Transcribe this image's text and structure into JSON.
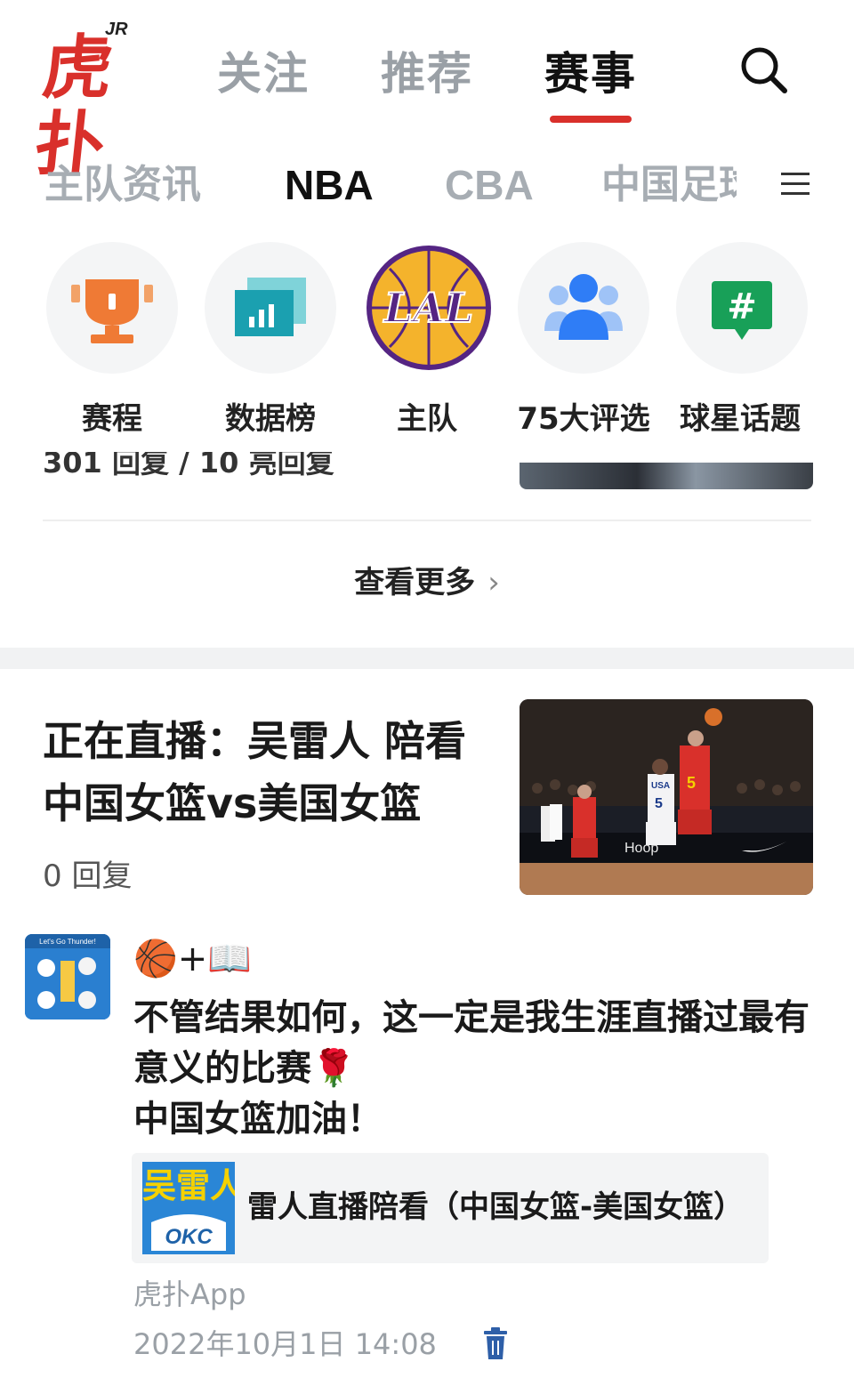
{
  "app": {
    "logo_text": "虎扑",
    "logo_badge": "JR",
    "brand_color": "#d9302b"
  },
  "top_tabs": [
    {
      "label": "关注",
      "active": false
    },
    {
      "label": "推荐",
      "active": false
    },
    {
      "label": "赛事",
      "active": true
    }
  ],
  "sub_tabs": [
    {
      "label": "主队资讯",
      "active": false
    },
    {
      "label": "NBA",
      "active": true
    },
    {
      "label": "CBA",
      "active": false
    },
    {
      "label": "中国足球",
      "active": false
    }
  ],
  "icons": {
    "search": "search-icon",
    "menu": "hamburger-menu-icon",
    "chevron": "chevron-right-icon",
    "trash": "trash-icon"
  },
  "shortcuts": [
    {
      "label": "赛程",
      "icon": "trophy-icon"
    },
    {
      "label": "数据榜",
      "icon": "bar-chart-icon"
    },
    {
      "label": "主队",
      "icon": "lakers-logo-icon",
      "badge_text": "LAL"
    },
    {
      "label": "75大评选",
      "icon": "people-icon"
    },
    {
      "label": "球星话题",
      "icon": "topic-hash-icon",
      "badge_text": "#"
    }
  ],
  "previous_item": {
    "replies_text": "301 回复 / 10 亮回复"
  },
  "view_more": {
    "label": "查看更多",
    "chevron": "›"
  },
  "article": {
    "title": "正在直播：吴雷人 陪看中国女篮vs美国女篮",
    "replies": "0 回复",
    "image_labels": {
      "jersey_usa": "USA",
      "usa_number": "5",
      "china_number": "5",
      "court_text": "Hoop"
    }
  },
  "post": {
    "name_emoji": "🏀+📖",
    "lines": [
      "不管结果如何，这一定是我生涯直播过最有意义的比赛🌹",
      "中国女篮加油！"
    ],
    "avatar_text": "Let's Go Thunder!",
    "share": {
      "thumb_text": "吴雷人",
      "thumb_logo": "OKC",
      "title": "雷人直播陪看（中国女篮-美国女篮）"
    },
    "source": "虎扑App",
    "timestamp": "2022年10月1日 14:08"
  }
}
